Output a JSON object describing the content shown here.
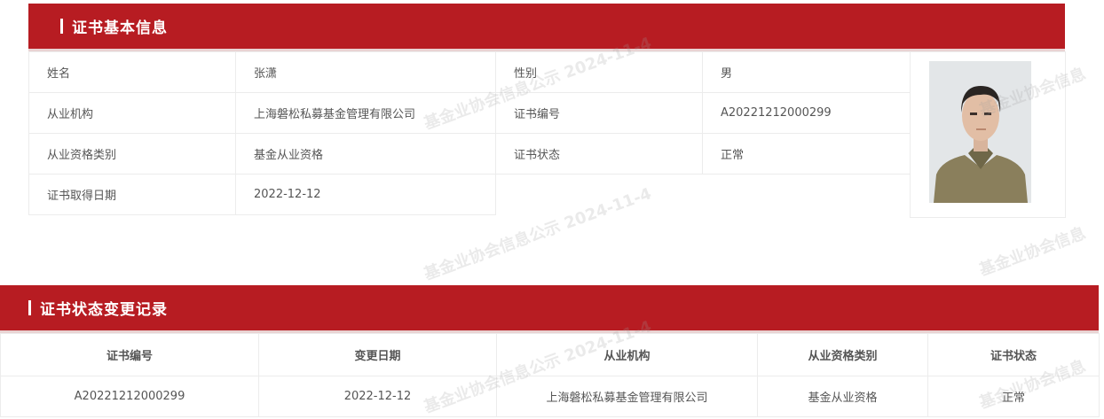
{
  "section1": {
    "title": "证书基本信息"
  },
  "info": {
    "rows": [
      {
        "label1": "姓名",
        "value1": "张潇",
        "label2": "性别",
        "value2": "男"
      },
      {
        "label1": "从业机构",
        "value1": "上海磐松私募基金管理有限公司",
        "label2": "证书编号",
        "value2": "A20221212000299"
      },
      {
        "label1": "从业资格类别",
        "value1": "基金从业资格",
        "label2": "证书状态",
        "value2": "正常"
      },
      {
        "label1": "证书取得日期",
        "value1": "2022-12-12"
      }
    ]
  },
  "section2": {
    "title": "证书状态变更记录"
  },
  "records": {
    "headers": [
      "证书编号",
      "变更日期",
      "从业机构",
      "从业资格类别",
      "证书状态"
    ],
    "rows": [
      [
        "A20221212000299",
        "2022-12-12",
        "上海磐松私募基金管理有限公司",
        "基金从业资格",
        "正常"
      ]
    ]
  },
  "watermark": {
    "text1": "基金业协会信息公示 2024-11-4",
    "text2": "基金业协会信息"
  }
}
